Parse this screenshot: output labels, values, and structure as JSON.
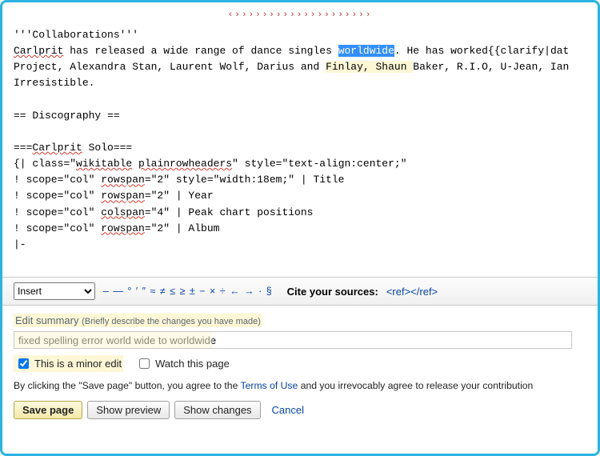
{
  "editor": {
    "top_artifact": "‹››››››››››››››››››››",
    "line_collab": "'''Collaborations'''",
    "line_body_pre": " has released a wide range of dance singles ",
    "name_carlprit": "Carlprit",
    "word_worldwide": "worldwide",
    "line_body_post": ". He has worked{{clarify|dat",
    "line_body2_a": "Project, Alexandra Stan, Laurent Wolf, Darius and ",
    "line_body2_hl": "Finlay, Shaun ",
    "line_body2_b": "Baker, R.I.O, U-Jean, Ian",
    "line_irr": "Irresistible.",
    "line_disc": "== Discography ==",
    "line_solo_a": "===",
    "line_solo_b": " Solo===",
    "line_tbl_open_a": "{| class=\"",
    "word_wikitable": "wikitable",
    "word_plainrow": "plainrowheaders",
    "line_tbl_open_b": "\" style=\"text-align:center;\"",
    "line_t1a": "! scope=\"col\" ",
    "word_rowspan": "rowspan",
    "line_t1b": "=\"2\" style=\"width:18em;\" | Title",
    "line_t2b": "=\"2\" | Year",
    "line_t3a": "! scope=\"col\" ",
    "word_colspan": "colspan",
    "line_t3b": "=\"4\" | Peak chart positions",
    "line_t4b": "=\"2\" | Album",
    "line_row": "|-"
  },
  "toolbar": {
    "insert_label": "Insert",
    "symbols": "– — ° ′ ″ ≈ ≠ ≤ ≥ ± − × ÷ ← → · §",
    "cite_label": "Cite your sources:",
    "cite_ref": "<ref></ref>"
  },
  "summary": {
    "head": "Edit summary",
    "note": "(Briefly describe the changes you have made)",
    "value": "fixed spelling error world wide to worldwide"
  },
  "checks": {
    "minor": "This is a minor edit",
    "watch": "Watch this page"
  },
  "agree": {
    "pre": "By clicking the \"Save page\" button, you agree to the ",
    "terms": "Terms of Use",
    "post": " and you irrevocably agree to release your contribution"
  },
  "buttons": {
    "save": "Save page",
    "preview": "Show preview",
    "changes": "Show changes",
    "cancel": "Cancel"
  }
}
